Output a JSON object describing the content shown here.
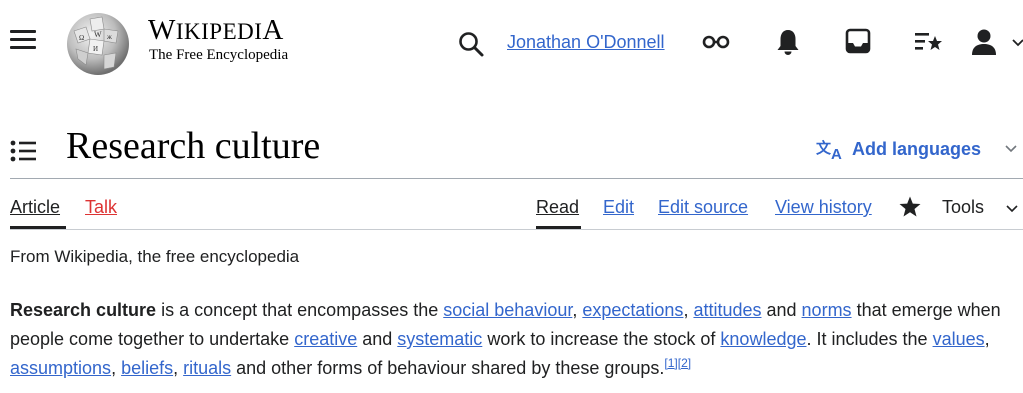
{
  "header": {
    "wordmark": "Wikipedia",
    "tagline": "The Free Encyclopedia",
    "user": "Jonathan O'Donnell"
  },
  "page": {
    "title": "Research culture",
    "add_languages": "Add languages",
    "tabs": {
      "article": "Article",
      "talk": "Talk",
      "read": "Read",
      "edit": "Edit",
      "edit_source": "Edit source",
      "view_history": "View history",
      "tools": "Tools"
    },
    "from": "From Wikipedia, the free encyclopedia"
  },
  "paragraph": {
    "bold_term": "Research culture",
    "t1": " is a concept that encompasses the ",
    "l1": "social behaviour",
    "t2": ", ",
    "l2": "expectations",
    "t3": ", ",
    "l3": "attitudes",
    "t4": " and ",
    "l4": "norms",
    "t5": " that emerge when people come together to undertake ",
    "l5": "creative",
    "t6": " and ",
    "l6": "systematic",
    "t7": " work to increase the stock of ",
    "l7": "knowledge",
    "t8": ". It includes the ",
    "l8": "values",
    "t9": ", ",
    "l9": "assumptions",
    "t10": ", ",
    "l10": "beliefs",
    "t11": ", ",
    "l11": "rituals",
    "t12": " and other forms of behaviour shared by these groups.",
    "ref1": "[1]",
    "ref2": "[2]"
  },
  "colors": {
    "link": "#3366cc",
    "link_missing": "#d33",
    "text": "#202122",
    "rule": "#a2a9b1"
  },
  "icons": [
    "menu-icon",
    "wikipedia-globe-logo",
    "search-icon",
    "appearance-icon",
    "notifications-bell-icon",
    "inbox-icon",
    "watchlist-icon",
    "user-icon",
    "chevron-down-icon",
    "toc-icon",
    "translate-icon",
    "star-icon"
  ]
}
